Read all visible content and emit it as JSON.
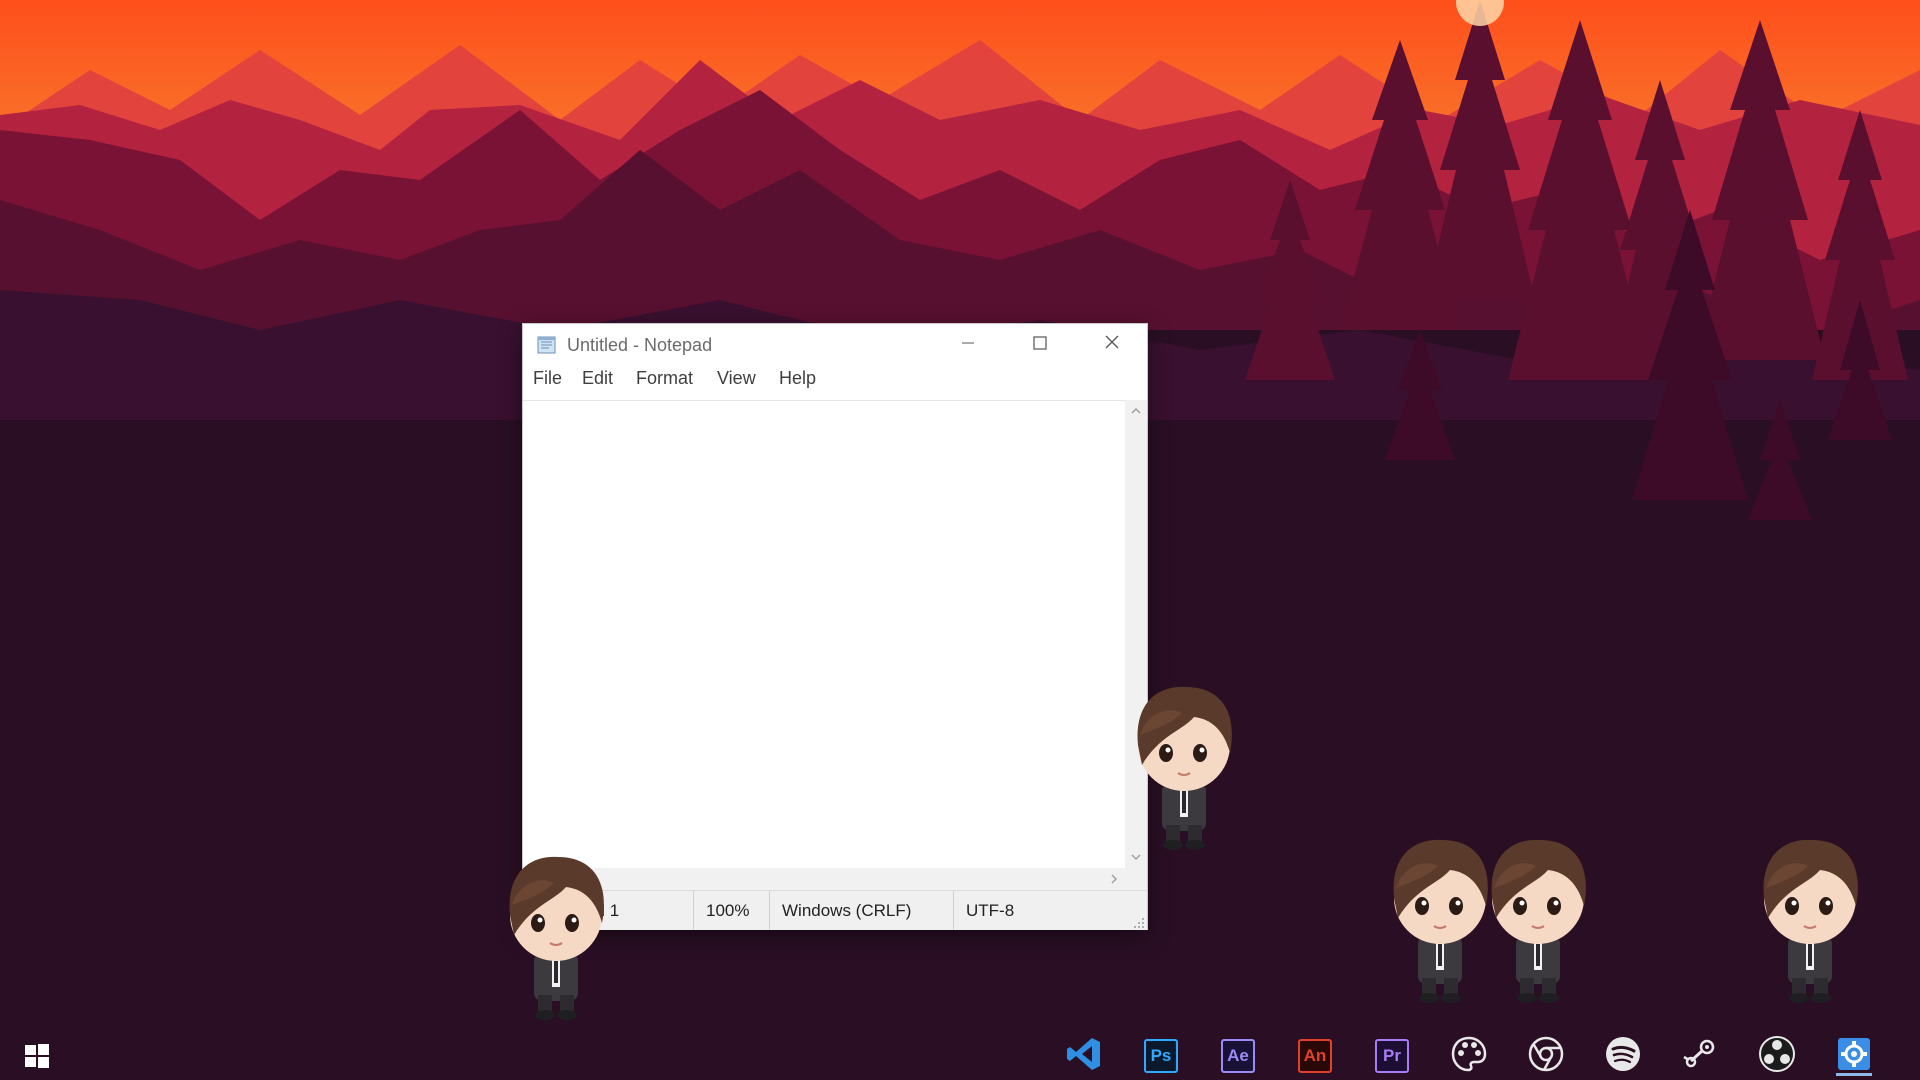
{
  "window": {
    "title": "Untitled - Notepad",
    "menu": [
      "File",
      "Edit",
      "Format",
      "View",
      "Help"
    ],
    "editor_text": "",
    "status": {
      "position": "Ln 1, Col 1",
      "zoom": "100%",
      "line_ending": "Windows (CRLF)",
      "encoding": "UTF-8"
    }
  },
  "taskbar": {
    "apps": [
      {
        "name": "Visual Studio Code",
        "label": "",
        "icon": "vscode-icon",
        "color": "#2f8fe3"
      },
      {
        "name": "Photoshop",
        "label": "Ps",
        "icon": "photoshop-icon",
        "color": "#31a8ff"
      },
      {
        "name": "After Effects",
        "label": "Ae",
        "icon": "after-effects-icon",
        "color": "#9a8cf5"
      },
      {
        "name": "Animate",
        "label": "An",
        "icon": "animate-icon",
        "color": "#e0412d"
      },
      {
        "name": "Premiere Pro",
        "label": "Pr",
        "icon": "premiere-icon",
        "color": "#a87cf6"
      },
      {
        "name": "Paint",
        "label": "",
        "icon": "palette-icon",
        "color": "#e8e8e8"
      },
      {
        "name": "Chrome",
        "label": "",
        "icon": "chrome-icon",
        "color": "#e8e8e8"
      },
      {
        "name": "Spotify",
        "label": "",
        "icon": "spotify-icon",
        "color": "#e8e8e8"
      },
      {
        "name": "Steam",
        "label": "",
        "icon": "steam-icon",
        "color": "#e8e8e8"
      },
      {
        "name": "OBS",
        "label": "",
        "icon": "obs-icon",
        "color": "#e8e8e8"
      },
      {
        "name": "Settings",
        "label": "",
        "icon": "settings-icon",
        "color": "#3a8ee6"
      }
    ]
  },
  "colors": {
    "sky_top": "#ff5a1f",
    "sky_mid": "#f77a2a",
    "far_mountain": "#d9384a",
    "mid_mountain": "#a8203f",
    "near_mountain": "#6d0f33",
    "ground": "#2a0f24"
  }
}
